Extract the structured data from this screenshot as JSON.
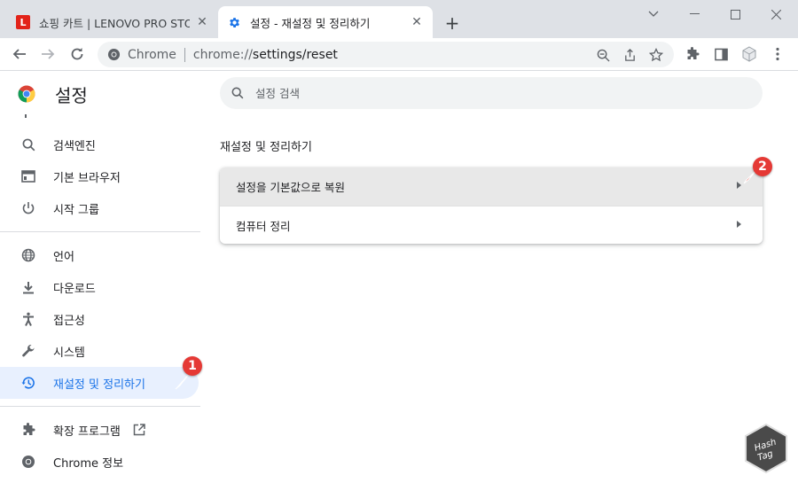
{
  "tabs": [
    {
      "title": "쇼핑 카트 | LENOVO PRO STORE",
      "favicon": "L",
      "favicon_color": "#e2231a",
      "active": false
    },
    {
      "title": "설정 - 재설정 및 정리하기",
      "active": true
    }
  ],
  "toolbar": {
    "omnibox_chip": "Chrome",
    "url_host": "chrome://",
    "url_path": "settings/reset"
  },
  "settings": {
    "title": "설정",
    "search_placeholder": "설정 검색",
    "nav": [
      {
        "label": "검색엔진",
        "icon": "search-icon"
      },
      {
        "label": "기본 브라우저",
        "icon": "browser-icon"
      },
      {
        "label": "시작 그룹",
        "icon": "power-icon"
      },
      {
        "label": "언어",
        "icon": "globe-icon"
      },
      {
        "label": "다운로드",
        "icon": "download-icon"
      },
      {
        "label": "접근성",
        "icon": "accessibility-icon"
      },
      {
        "label": "시스템",
        "icon": "wrench-icon"
      },
      {
        "label": "재설정 및 정리하기",
        "icon": "restore-icon",
        "selected": true
      },
      {
        "label": "확장 프로그램",
        "icon": "puzzle-icon"
      },
      {
        "label": "Chrome 정보",
        "icon": "chrome-icon"
      }
    ],
    "section_title": "재설정 및 정리하기",
    "rows": [
      {
        "label": "설정을 기본값으로 복원"
      },
      {
        "label": "컴퓨터 정리"
      }
    ]
  },
  "annotations": {
    "marker1": "1",
    "marker2": "2"
  },
  "watermark": {
    "line1": "Hash",
    "line2": "Tag"
  },
  "colors": {
    "accent": "#1a73e8",
    "selected_bg": "#e8f0fe",
    "marker": "#e53935"
  }
}
